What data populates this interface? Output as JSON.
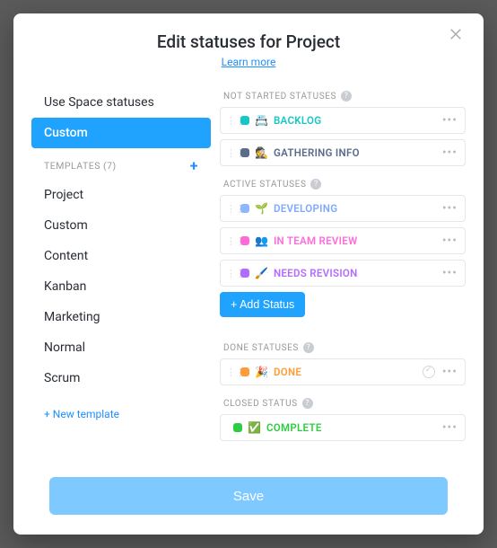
{
  "header": {
    "title": "Edit statuses for Project",
    "learn_more": "Learn more"
  },
  "left": {
    "use_space": "Use Space statuses",
    "custom": "Custom",
    "templates_header": "TEMPLATES (7)",
    "templates": [
      "Project",
      "Custom",
      "Content",
      "Kanban",
      "Marketing",
      "Normal",
      "Scrum"
    ],
    "new_template": "+ New template"
  },
  "groups": {
    "not_started": {
      "title": "NOT STARTED STATUSES",
      "items": [
        {
          "color": "#17c7c7",
          "emoji": "📇",
          "label": "BACKLOG",
          "label_color": "#17c7c7"
        },
        {
          "color": "#5a6b8c",
          "emoji": "🕵️",
          "label": "GATHERING INFO",
          "label_color": "#5a6b8c"
        }
      ]
    },
    "active": {
      "title": "ACTIVE STATUSES",
      "items": [
        {
          "color": "#8fb6ff",
          "emoji": "🌱",
          "label": "DEVELOPING",
          "label_color": "#7fa8ff"
        },
        {
          "color": "#ff6bd6",
          "emoji": "👥",
          "label": "IN TEAM REVIEW",
          "label_color": "#ff6bd6"
        },
        {
          "color": "#b36bff",
          "emoji": "🖌️",
          "label": "NEEDS REVISION",
          "label_color": "#b36bff"
        }
      ],
      "add": "+ Add Status"
    },
    "done": {
      "title": "DONE STATUSES",
      "items": [
        {
          "color": "#ff9b3b",
          "emoji": "🎉",
          "label": "DONE",
          "label_color": "#ff9b3b"
        }
      ]
    },
    "closed": {
      "title": "CLOSED STATUS",
      "item": {
        "color": "#2ecc40",
        "emoji": "✅",
        "label": "COMPLETE",
        "label_color": "#2ecc40"
      }
    }
  },
  "footer": {
    "save": "Save"
  }
}
